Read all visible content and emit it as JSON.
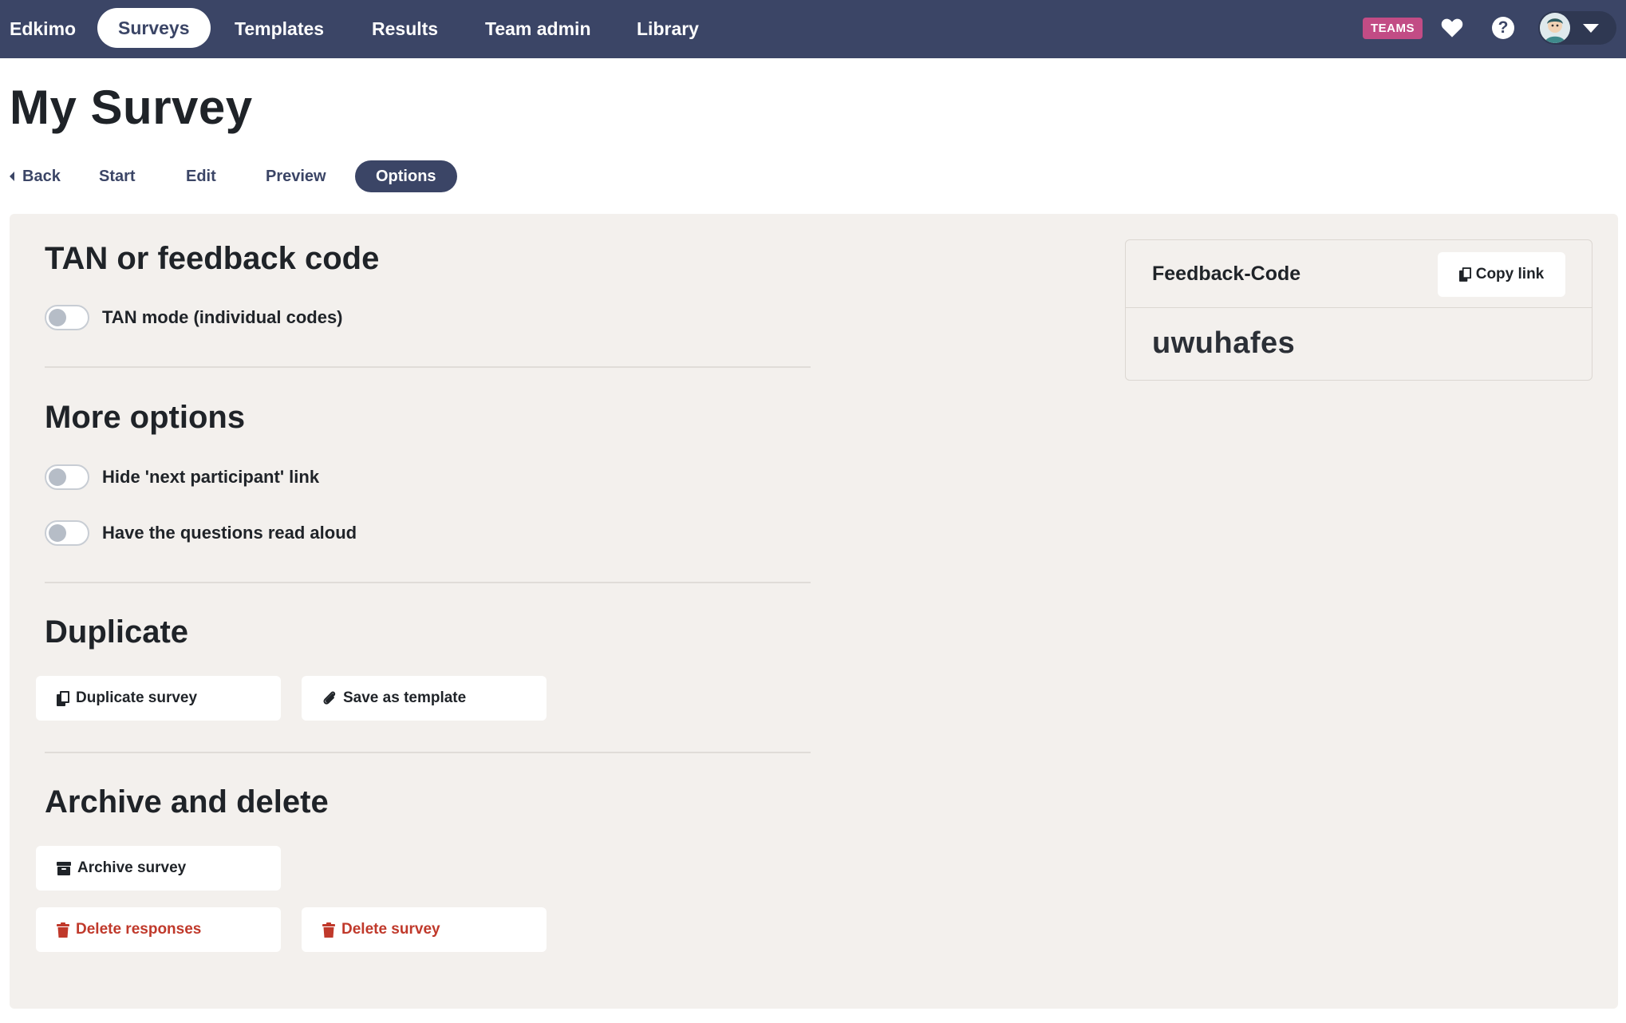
{
  "nav": {
    "brand": "Edkimo",
    "items": [
      {
        "label": "Surveys",
        "active": true
      },
      {
        "label": "Templates",
        "active": false
      },
      {
        "label": "Results",
        "active": false
      },
      {
        "label": "Team admin",
        "active": false
      },
      {
        "label": "Library",
        "active": false
      }
    ],
    "badge": "TEAMS",
    "icons": [
      "heart-icon",
      "help-icon",
      "avatar",
      "chevron-down-icon"
    ]
  },
  "page": {
    "title": "My Survey"
  },
  "subnav": {
    "back": "Back",
    "tabs": [
      {
        "label": "Start",
        "active": false
      },
      {
        "label": "Edit",
        "active": false
      },
      {
        "label": "Preview",
        "active": false
      },
      {
        "label": "Options",
        "active": true
      }
    ]
  },
  "sections": {
    "tan": {
      "heading": "TAN or feedback code",
      "toggle_label": "TAN mode (individual codes)",
      "toggle_on": false
    },
    "more": {
      "heading": "More options",
      "toggles": [
        {
          "label": "Hide 'next participant' link",
          "on": false
        },
        {
          "label": "Have the questions read aloud",
          "on": false
        }
      ]
    },
    "duplicate": {
      "heading": "Duplicate",
      "duplicate_label": "Duplicate survey",
      "template_label": "Save as template"
    },
    "archive": {
      "heading": "Archive and delete",
      "archive_label": "Archive survey",
      "delete_responses_label": "Delete responses",
      "delete_survey_label": "Delete survey"
    }
  },
  "feedback_card": {
    "title": "Feedback-Code",
    "copy_label": "Copy link",
    "code": "uwuhafes"
  },
  "colors": {
    "nav_bg": "#3b4566",
    "badge": "#c24c85",
    "panel_bg": "#f3f0ed",
    "danger": "#c0392b"
  }
}
